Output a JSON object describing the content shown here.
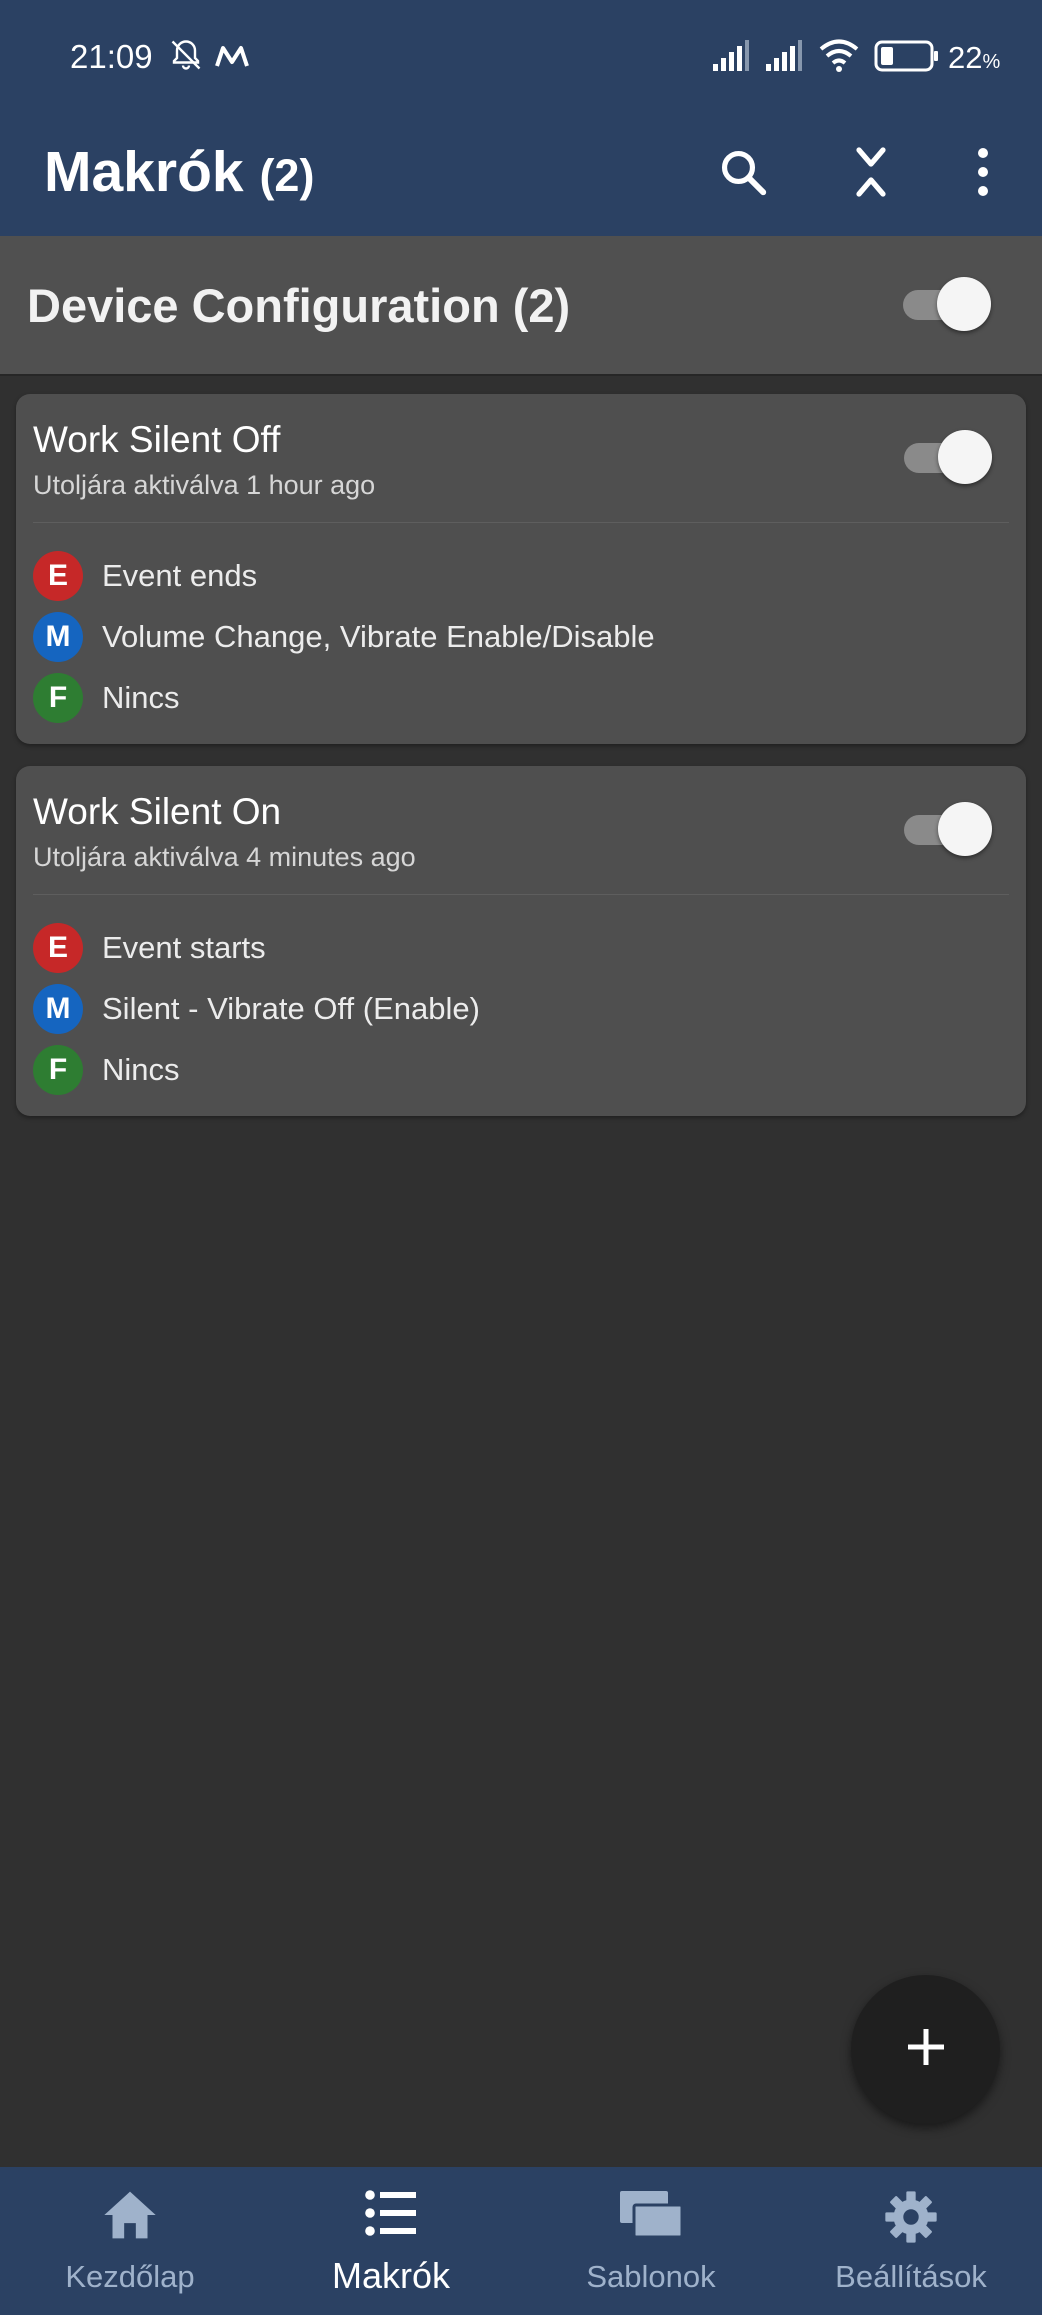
{
  "status_bar": {
    "time": "21:09",
    "battery_percent": "22",
    "battery_unit": "%",
    "icons": [
      "alarm-off-icon",
      "macrodroid-icon",
      "signal-icon",
      "signal-icon",
      "wifi-icon",
      "battery-icon"
    ]
  },
  "app_bar": {
    "title": "Makrók",
    "count": "(2)",
    "actions": [
      "search-icon",
      "collapse-icon",
      "more-vert-icon"
    ]
  },
  "category": {
    "title": "Device Configuration (2)",
    "enabled": true
  },
  "macros": [
    {
      "name": "Work Silent Off",
      "last_run": "Utoljára aktiválva 1 hour ago",
      "enabled": true,
      "trigger_badge": "E",
      "trigger": "Event ends",
      "action_badge": "M",
      "action": "Volume Change, Vibrate Enable/Disable",
      "constraint_badge": "F",
      "constraint": "Nincs"
    },
    {
      "name": "Work Silent On",
      "last_run": "Utoljára aktiválva 4 minutes ago",
      "enabled": true,
      "trigger_badge": "E",
      "trigger": "Event starts",
      "action_badge": "M",
      "action": "Silent - Vibrate Off (Enable)",
      "constraint_badge": "F",
      "constraint": "Nincs"
    }
  ],
  "fab": {
    "icon": "add-icon"
  },
  "bottom_nav": {
    "active": "Makrók",
    "items": [
      {
        "label": "Kezdőlap",
        "icon": "home-icon"
      },
      {
        "label": "Makrók",
        "icon": "list-icon"
      },
      {
        "label": "Sablonok",
        "icon": "templates-icon"
      },
      {
        "label": "Beállítások",
        "icon": "settings-icon"
      }
    ]
  },
  "colors": {
    "bar_background": "#2b4163",
    "page_background": "#303030",
    "card_background": "#4f4f4f",
    "trigger_badge": "#c62828",
    "action_badge": "#1565c0",
    "constraint_badge": "#2e7d32"
  }
}
